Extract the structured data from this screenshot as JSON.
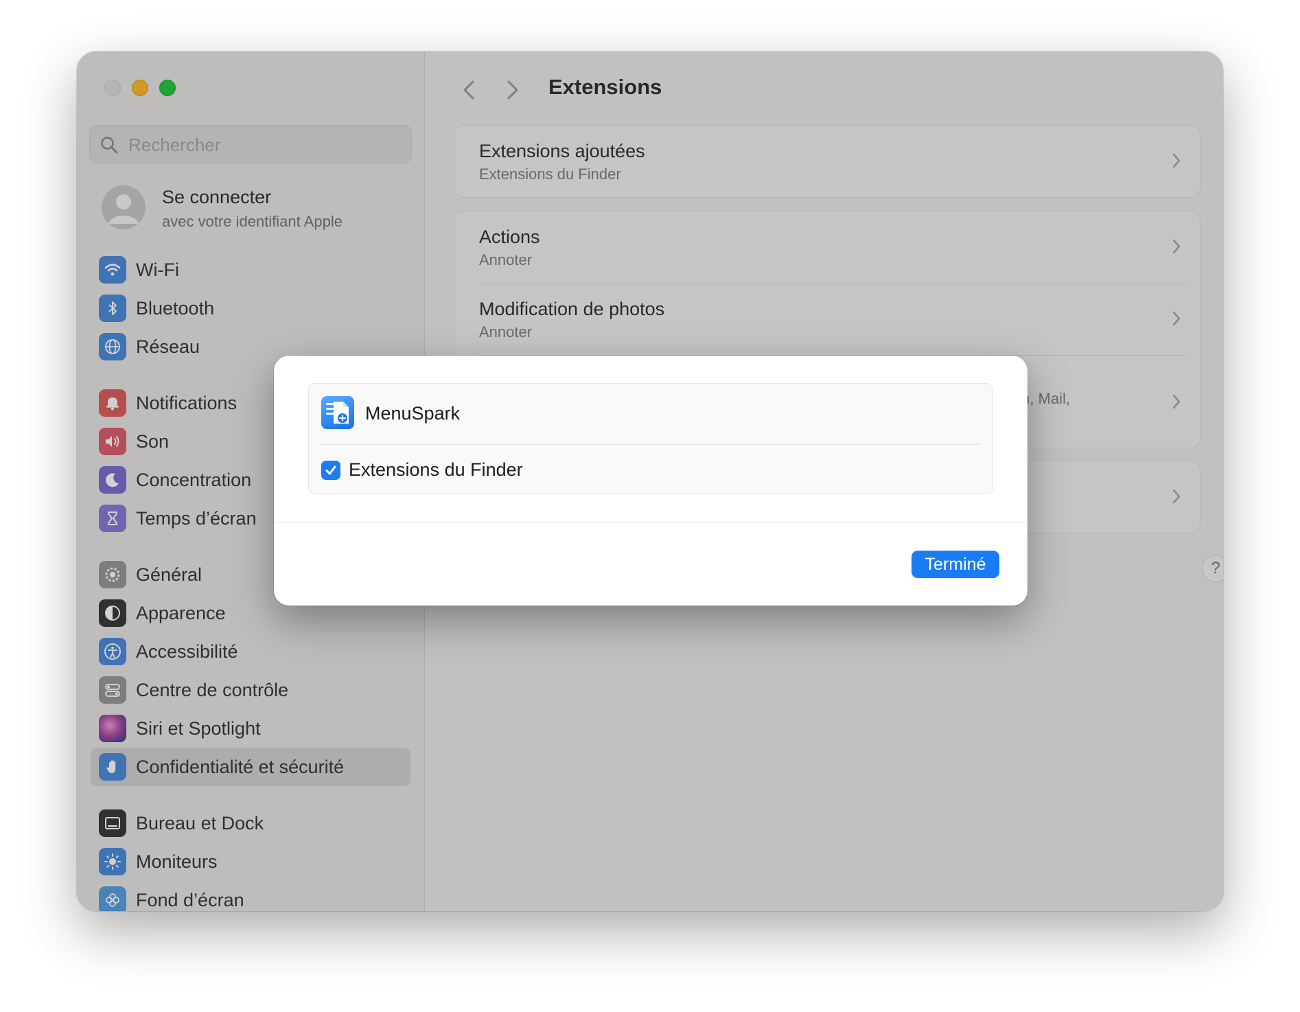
{
  "sidebar": {
    "search_placeholder": "Rechercher",
    "account": {
      "name": "Se connecter",
      "subtitle": "avec votre identifiant Apple"
    },
    "items": [
      {
        "label": "Wi-Fi",
        "icon": "wifi-icon",
        "color": "#4f8ddc"
      },
      {
        "label": "Bluetooth",
        "icon": "bluetooth-icon",
        "color": "#4f8ddc"
      },
      {
        "label": "Réseau",
        "icon": "globe-icon",
        "color": "#4f8ddc"
      },
      {
        "label": "Notifications",
        "icon": "bell-icon",
        "color": "#e06060"
      },
      {
        "label": "Son",
        "icon": "speaker-icon",
        "color": "#e06070"
      },
      {
        "label": "Concentration",
        "icon": "moon-icon",
        "color": "#7b6fd0"
      },
      {
        "label": "Temps d’écran",
        "icon": "hourglass-icon",
        "color": "#8d7ad6"
      },
      {
        "label": "Général",
        "icon": "gear-icon",
        "color": "#9a9a9a"
      },
      {
        "label": "Apparence",
        "icon": "appearance-icon",
        "color": "#3b3b3b"
      },
      {
        "label": "Accessibilité",
        "icon": "accessibility-icon",
        "color": "#4f8ddc"
      },
      {
        "label": "Centre de contrôle",
        "icon": "control-center-icon",
        "color": "#9a9a9a"
      },
      {
        "label": "Siri et Spotlight",
        "icon": "siri-icon",
        "color": "#b04ca8"
      },
      {
        "label": "Confidentialité et sécurité",
        "icon": "hand-icon",
        "color": "#4f8ddc",
        "selected": true
      },
      {
        "label": "Bureau et Dock",
        "icon": "dock-icon",
        "color": "#3b3b3b"
      },
      {
        "label": "Moniteurs",
        "icon": "sun-icon",
        "color": "#4f8ddc"
      },
      {
        "label": "Fond d’écran",
        "icon": "flower-icon",
        "color": "#5aa0e0"
      }
    ]
  },
  "main": {
    "title": "Extensions",
    "card1": {
      "title": "Extensions ajoutées",
      "subtitle": "Extensions du Finder"
    },
    "card2": [
      {
        "title": "Actions",
        "subtitle": "Annoter"
      },
      {
        "title": "Modification de photos",
        "subtitle": "Annoter"
      },
      {
        "title": "",
        "subtitle": "m, Mail,"
      }
    ],
    "help_label": "?"
  },
  "modal": {
    "app_name": "MenuSpark",
    "app_icon": "menuspark-app-icon",
    "checkbox_label": "Extensions du Finder",
    "checkbox_checked": true,
    "done_label": "Terminé",
    "accent_color": "#1a7cf5"
  }
}
